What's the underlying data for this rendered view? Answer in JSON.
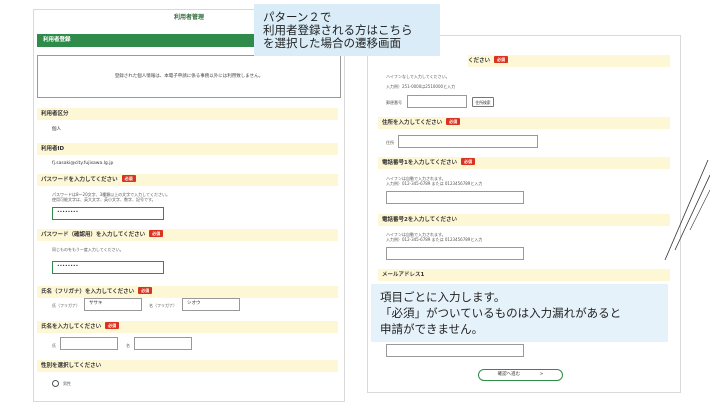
{
  "left_page": {
    "title": "利用者管理",
    "header": "利用者登録",
    "notice": "登録された個人情報は、本電子申請に係る事務以外には利用致しません。",
    "user_type": {
      "label": "利用者区分",
      "value": "個人"
    },
    "user_id": {
      "label": "利用者ID",
      "value": "fj.sasaki@city.fujisawa.lg.jp"
    },
    "password": {
      "label": "パスワードを入力してください",
      "required": "必須",
      "hint1": "パスワードは8〜20文字、3種類以上の文字で入力してください。",
      "hint2": "使用可能文字は、英大文字、英小文字、数字、記号です。",
      "value": "••••••••"
    },
    "password_confirm": {
      "label": "パスワード（確認用）を入力してください",
      "required": "必須",
      "hint": "同じものをもう一度入力してください。",
      "value": "••••••••"
    },
    "name_kana": {
      "label": "氏名（フリガナ）を入力してください",
      "required": "必須",
      "last_label": "氏（フリガナ）",
      "last_value": "ササキ",
      "first_label": "名（フリガナ）",
      "first_value": "シオウ"
    },
    "name": {
      "label": "氏名を入力してください",
      "required": "必須",
      "last_label": "氏",
      "first_label": "名"
    },
    "gender": {
      "label": "性別を選択してください",
      "option1": "男性"
    }
  },
  "right_page": {
    "postal": {
      "label_suffix": "ください",
      "required": "必須",
      "hint1": "ハイフンなしで入力してください。",
      "hint2": "入力例）251-0000は2510000と入力",
      "field_label": "郵便番号",
      "button": "住所検索"
    },
    "address": {
      "label": "住所を入力してください",
      "required": "必須",
      "field_label": "住所"
    },
    "phone1": {
      "label": "電話番号1を入力してください",
      "required": "必須",
      "hint1": "ハイフンは自動で入力されます。",
      "hint2": "入力例）012-345-6789 または 0123456789と入力"
    },
    "phone2": {
      "label": "電話番号2を入力してください",
      "hint1": "ハイフンは自動で入力されます。",
      "hint2": "入力例）012-345-6789 または 0123456789と入力"
    },
    "email1": {
      "label": "メールアドレス1"
    },
    "confirm_button": "確認へ進む",
    "confirm_arrow": ">"
  },
  "callout_top": {
    "line1": "パターン２で",
    "line2": "利用者登録される方はこちら",
    "line3": "を選択した場合の遷移画面"
  },
  "callout_bottom": {
    "line1": "項目ごとに入力します。",
    "line2": "「必須」がついているものは入力漏れがあると",
    "line3": "申請ができません。"
  }
}
